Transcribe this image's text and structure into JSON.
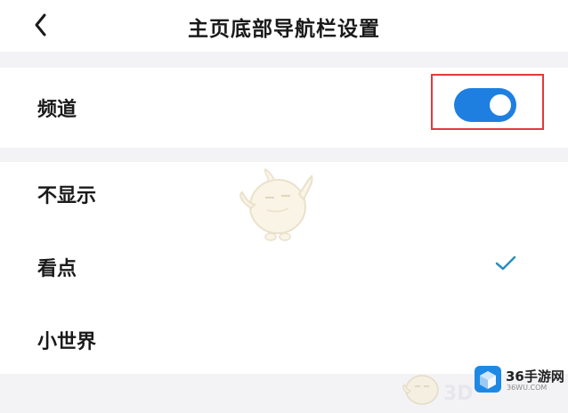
{
  "header": {
    "title": "主页底部导航栏设置",
    "back_icon": "chevron-left-icon"
  },
  "channel": {
    "label": "频道",
    "enabled": true,
    "toggle_color": "#1e7fe0",
    "highlight_color": "#e23a3a"
  },
  "options": {
    "items": [
      {
        "label": "不显示",
        "selected": false
      },
      {
        "label": "看点",
        "selected": true
      },
      {
        "label": "小世界",
        "selected": false
      }
    ],
    "check_icon": "checkmark-icon",
    "check_color": "#2a8fbf"
  },
  "watermark": {
    "brand": "36手游网",
    "domain": "36WU.COM",
    "faint_text": "3D"
  }
}
